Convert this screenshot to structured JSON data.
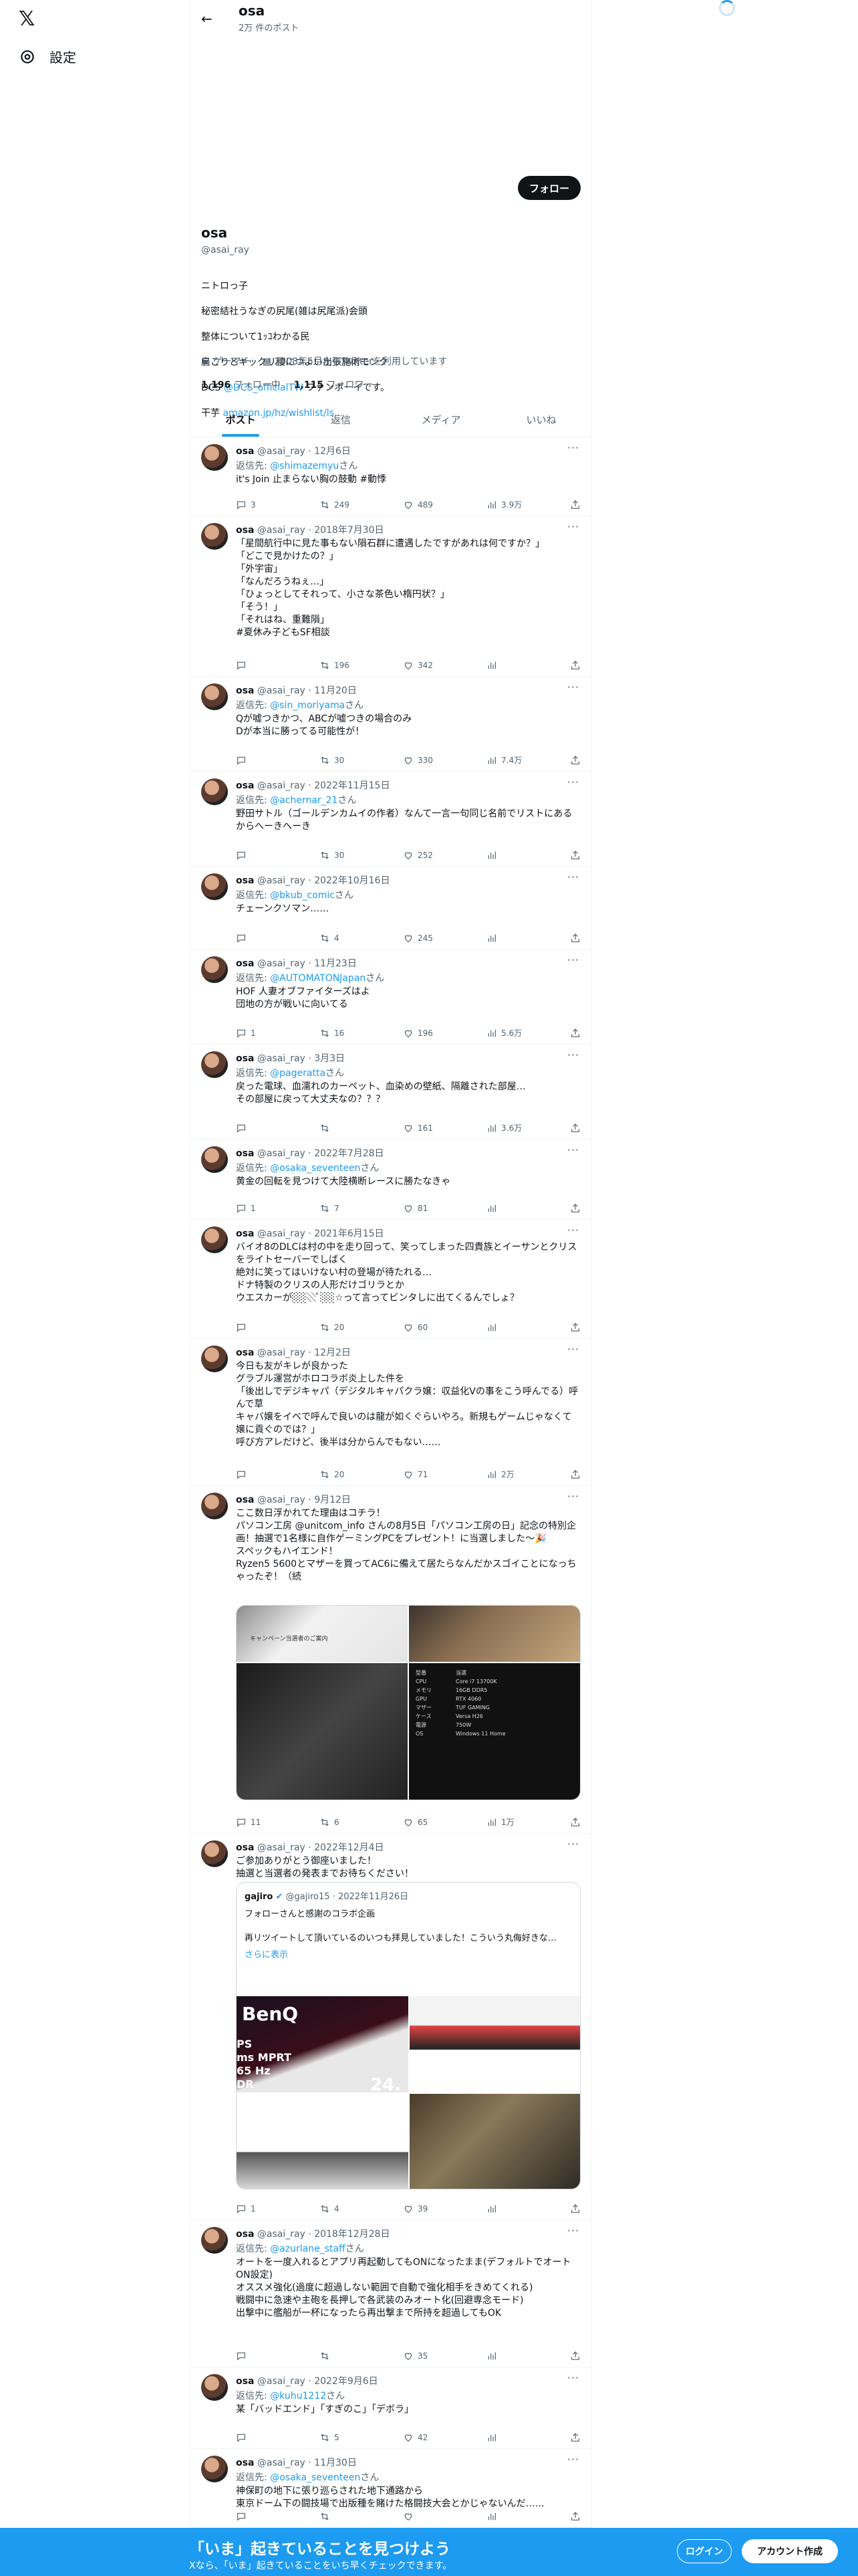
{
  "nav": {
    "logo": "𝕏",
    "settings_label": "設定"
  },
  "header": {
    "name": "osa",
    "post_count": "2万 件のポスト"
  },
  "profile": {
    "follow_label": "フォロー",
    "name": "osa",
    "handle": "@asai_ray",
    "bio_line1": "ニトロっ子",
    "bio_line2": "秘密結社うなぎの尻尾(雑は尻尾派)会頭",
    "bio_line3": "整体について1ｯｺわかる民",
    "bio_line4": "肩こりとギックリ腰につよい出張施術モンク",
    "bio_dcs_prefix": "DCS ",
    "bio_dcs_link": "@DCS_officialTW",
    "bio_dcs_suffix": " ファンボーイです。",
    "bio_amazon_prefix": "干芋 ",
    "bio_amazon_link": "amazon.jp/hz/wishlist/ls…",
    "category": "ゲーマー",
    "joined": "2008年5月からTwitterを利用しています",
    "following_count": "1,196",
    "following_label": "フォロー中",
    "followers_count": "1,115",
    "followers_label": "フォロワー"
  },
  "tabs": [
    "ポスト",
    "返信",
    "メディア",
    "いいね"
  ],
  "tweets": [
    {
      "name": "osa",
      "handle": "@asai_ray",
      "date": "12月6日",
      "reply_to": "@shimazemyu",
      "text": "it's Join 止まらない胸の鼓動 #動悸",
      "replies": "3",
      "retweets": "249",
      "likes": "489",
      "views": "3.9万"
    },
    {
      "name": "osa",
      "handle": "@asai_ray",
      "date": "2018年7月30日",
      "reply_to": "",
      "text": "「星間航行中に見た事もない隕石群に遭遇したですがあれは何ですか？」\n「どこで見かけたの？」\n「外宇宙」\n「なんだろうねぇ…」\n「ひょっとしてそれって、小さな茶色い楕円状？」\n「そう！」\n「それはね、重難隕」\n#夏休み子どもSF相談",
      "replies": "",
      "retweets": "196",
      "likes": "342",
      "views": ""
    },
    {
      "name": "osa",
      "handle": "@asai_ray",
      "date": "11月20日",
      "reply_to": "@sin_moriyama",
      "text": "Qが嘘つきかつ、ABCが嘘つきの場合のみ\nDが本当に勝ってる可能性が！",
      "replies": "",
      "retweets": "30",
      "likes": "330",
      "views": "7.4万"
    },
    {
      "name": "osa",
      "handle": "@asai_ray",
      "date": "2022年11月15日",
      "reply_to": "@achernar_21",
      "text": "野田サトル（ゴールデンカムイの作者）なんて一言一句同じ名前でリストにあるからへーきへーき",
      "replies": "",
      "retweets": "30",
      "likes": "252",
      "views": ""
    },
    {
      "name": "osa",
      "handle": "@asai_ray",
      "date": "2022年10月16日",
      "reply_to": "@bkub_comic",
      "text": "チェーンクソマン……",
      "replies": "",
      "retweets": "4",
      "likes": "245",
      "views": ""
    },
    {
      "name": "osa",
      "handle": "@asai_ray",
      "date": "11月23日",
      "reply_to": "@AUTOMATONJapan",
      "text": "HOF 人妻オブファイターズはよ\n団地の方が戦いに向いてる",
      "replies": "1",
      "retweets": "16",
      "likes": "196",
      "views": "5.6万"
    },
    {
      "name": "osa",
      "handle": "@asai_ray",
      "date": "3月3日",
      "reply_to": "@pageratta",
      "text": "戻った電球、血濡れのカーペット、血染めの壁紙、隔離された部屋…\nその部屋に戻って大丈夫なの？？？",
      "replies": "",
      "retweets": "",
      "likes": "161",
      "views": "3.6万"
    },
    {
      "name": "osa",
      "handle": "@asai_ray",
      "date": "2022年7月28日",
      "reply_to": "@osaka_seventeen",
      "text": "黄金の回転を見つけて大陸横断レースに勝たなきゃ",
      "replies": "1",
      "retweets": "7",
      "likes": "81",
      "views": ""
    },
    {
      "name": "osa",
      "handle": "@asai_ray",
      "date": "2021年6月15日",
      "reply_to": "",
      "text": "バイオ8のDLCは村の中を走り回って、笑ってしまった四貴族とイーサンとクリスをライトセーバーでしばく\n絶対に笑ってはいけない村の登場が待たれる…\nドナ特製のクリスの人形だけゴリラとか\nウエスカーが░░░ﾟ░░☆って言ってビンタしに出てくるんでしょ？",
      "replies": "",
      "retweets": "20",
      "likes": "60",
      "views": ""
    },
    {
      "name": "osa",
      "handle": "@asai_ray",
      "date": "12月2日",
      "reply_to": "",
      "text": "今日も友がキレが良かった\nグラブル運営がホロコラボ炎上した件を\n「後出しでデジキャパ（デジタルキャパクラ嬢：収益化Vの事をこう呼んでる）呼んで草\nキャバ嬢をイベで呼んで良いのは龍が如くぐらいやろ。新規もゲームじゃなくて嬢に貢ぐのでは？」\n呼び方アレだけど、後半は分からんでもない……",
      "replies": "",
      "retweets": "20",
      "likes": "71",
      "views": "2万"
    },
    {
      "name": "osa",
      "handle": "@asai_ray",
      "date": "9月12日",
      "reply_to": "",
      "text": "ここ数日浮かれてた理由はコチラ！\nパソコン工房 @unitcom_info さんの8月5日「パソコン工房の日」記念の特別企画！抽選で1名様に自作ゲーミングPCをプレゼント！に当選しました〜🎉\nスペックもハイエンド！\nRyzen5 5600とマザーを買ってAC6に備えて居たらなんだかスゴイことになっちゃったぞ！（続",
      "replies": "11",
      "retweets": "6",
      "likes": "65",
      "views": "1万"
    },
    {
      "name": "osa",
      "handle": "@asai_ray",
      "date": "2022年12月4日",
      "reply_to": "",
      "text": "ご参加ありがとう御座いました！\n抽選と当選者の発表までお待ちください！",
      "replies": "1",
      "retweets": "4",
      "likes": "39",
      "views": ""
    },
    {
      "name": "osa",
      "handle": "@asai_ray",
      "date": "2018年12月28日",
      "reply_to": "@azurlane_staff",
      "text": "オートを一度入れるとアプリ再起動してもONになったまま(デフォルトでオートON設定)\nオススメ強化(過度に超過しない範囲で自動で強化相手をきめてくれる)\n戦闘中に急速や主砲を長押しで各武装のみオート化(回避専念モード)\n出撃中に艦船が一杯になったら再出撃まで所持を超過してもOK",
      "replies": "",
      "retweets": "",
      "likes": "35",
      "views": ""
    },
    {
      "name": "osa",
      "handle": "@asai_ray",
      "date": "2022年9月6日",
      "reply_to": "@kuhu1212",
      "text": "某「バッドエンド」「すぎのこ」「デボラ」",
      "replies": "",
      "retweets": "5",
      "likes": "42",
      "views": ""
    },
    {
      "name": "osa",
      "handle": "@asai_ray",
      "date": "11月30日",
      "reply_to": "@osaka_seventeen",
      "text": "神保町の地下に張り巡らされた地下通路から\n東京ドーム下の闘技場で出版種を賭けた格闘技大会とかじゃないんだ……",
      "replies": "",
      "retweets": "",
      "likes": "",
      "views": ""
    }
  ],
  "reply_suffix": "さん",
  "reply_prefix": "返信先: ",
  "quote": {
    "name": "gajiro",
    "handle": "@gajiro15",
    "date": "2022年11月26日",
    "text": "フォローさんと感謝のコラボ企画\n\n再リツイートして頂いているのいつも拝見していました！こういう丸侮好きな…",
    "show_more": "さらに表示",
    "banner_brand": "BenQ",
    "banner_line1": "PS",
    "banner_line2": "ms MPRT",
    "banner_line3": "65 Hz",
    "banner_line4": "DR",
    "banner_size": "24."
  },
  "pc_media": {
    "spec_title": "キャンペーン当選者のご案内",
    "spec_rows": [
      [
        "型番",
        "当選"
      ],
      [
        "CPU",
        "Core i7 13700K"
      ],
      [
        "メモリ",
        "16GB DDR5"
      ],
      [
        "GPU",
        "RTX 4060"
      ],
      [
        "マザー",
        "TUF GAMING"
      ],
      [
        "ケース",
        "Versa H26"
      ],
      [
        "電源",
        "750W"
      ],
      [
        "OS",
        "Windows 11 Home"
      ]
    ]
  },
  "bottom": {
    "title": "「いま」起きていることを見つけよう",
    "subtitle": "Xなら、「いま」起きていることをいち早くチェックできます。",
    "login": "ログイン",
    "signup": "アカウント作成"
  },
  "colors": {
    "accent": "#1d9bf0",
    "bottom_bar": "#1d9bf0",
    "text": "#0f1419",
    "muted": "#536471"
  }
}
